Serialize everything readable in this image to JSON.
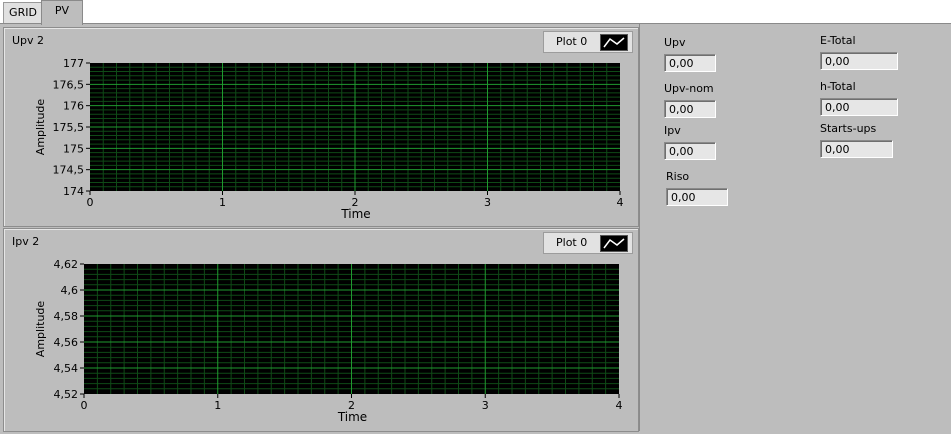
{
  "tabs": [
    {
      "label": "GRID",
      "active": false
    },
    {
      "label": "PV",
      "active": true
    }
  ],
  "colors": {
    "panel_bg": "#bdbdbd",
    "plot_bg": "#000000",
    "grid_major": "#1f9a2f",
    "grid_minor": "#0f4a17",
    "legend_line": "#ffffff"
  },
  "graphs": [
    {
      "title": "Upv 2",
      "legend_label": "Plot 0",
      "ylabel": "Amplitude",
      "xlabel": "Time",
      "x_ticks": [
        "0",
        "1",
        "2",
        "3",
        "4"
      ],
      "y_ticks": [
        "177",
        "176,5",
        "176",
        "175,5",
        "175",
        "174,5",
        "174"
      ]
    },
    {
      "title": "Ipv 2",
      "legend_label": "Plot 0",
      "ylabel": "Amplitude",
      "xlabel": "Time",
      "x_ticks": [
        "0",
        "1",
        "2",
        "3",
        "4"
      ],
      "y_ticks": [
        "4,62",
        "4,6",
        "4,58",
        "4,56",
        "4,54",
        "4,52"
      ]
    }
  ],
  "chart_data": [
    {
      "type": "line",
      "title": "Upv 2",
      "xlabel": "Time",
      "ylabel": "Amplitude",
      "xlim": [
        0,
        4
      ],
      "ylim": [
        174,
        177
      ],
      "grid": true,
      "legend": "top-right",
      "series": [
        {
          "name": "Plot 0",
          "x": [],
          "y": []
        }
      ]
    },
    {
      "type": "line",
      "title": "Ipv 2",
      "xlabel": "Time",
      "ylabel": "Amplitude",
      "xlim": [
        0,
        4
      ],
      "ylim": [
        4.52,
        4.62
      ],
      "grid": true,
      "legend": "top-right",
      "series": [
        {
          "name": "Plot 0",
          "x": [],
          "y": []
        }
      ]
    }
  ],
  "indicators": {
    "upv": {
      "label": "Upv",
      "value": "0,00"
    },
    "upv_nom": {
      "label": "Upv-nom",
      "value": "0,00"
    },
    "ipv": {
      "label": "Ipv",
      "value": "0,00"
    },
    "riso": {
      "label": "Riso",
      "value": "0,00"
    },
    "e_total": {
      "label": "E-Total",
      "value": "0,00"
    },
    "h_total": {
      "label": "h-Total",
      "value": "0,00"
    },
    "starts_ups": {
      "label": "Starts-ups",
      "value": "0,00"
    }
  }
}
